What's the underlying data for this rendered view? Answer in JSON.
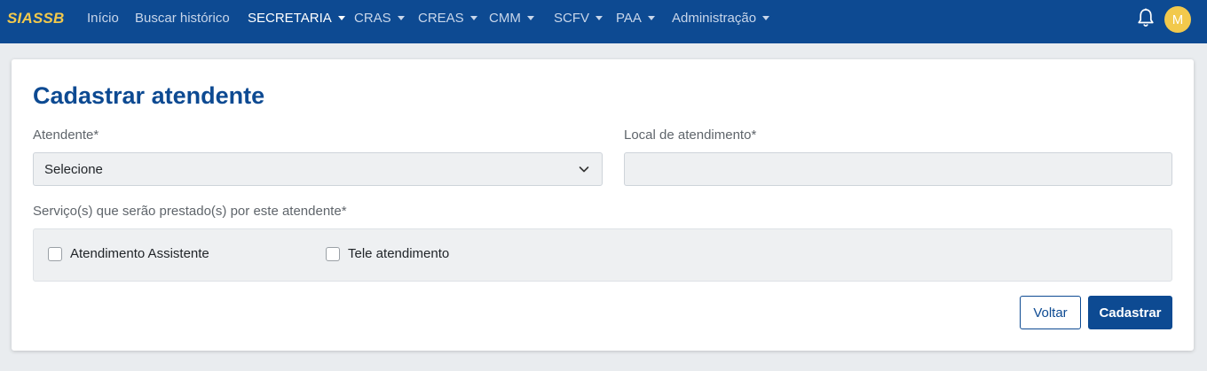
{
  "navbar": {
    "brand": "SIASSB",
    "items": [
      {
        "label": "Início",
        "dropdown": false
      },
      {
        "label": "Buscar histórico",
        "dropdown": false
      },
      {
        "label": "SECRETARIA",
        "dropdown": true
      },
      {
        "label": "CRAS",
        "dropdown": true
      },
      {
        "label": "CREAS",
        "dropdown": true
      },
      {
        "label": "CMM",
        "dropdown": true
      },
      {
        "label": "SCFV",
        "dropdown": true
      },
      {
        "label": "PAA",
        "dropdown": true
      },
      {
        "label": "Administração",
        "dropdown": true
      }
    ],
    "active_item": "SECRETARIA",
    "bell_icon": "bell-icon",
    "avatar_initial": "M"
  },
  "form": {
    "title": "Cadastrar atendente",
    "atendente_label": "Atendente*",
    "atendente_value": "Selecione",
    "local_label": "Local de atendimento*",
    "local_value": "",
    "servicos_label": "Serviço(s) que serão prestado(s) por este atendente*",
    "servicos": [
      {
        "label": "Atendimento Assistente",
        "checked": false
      },
      {
        "label": "Tele atendimento",
        "checked": false
      }
    ],
    "voltar_label": "Voltar",
    "cadastrar_label": "Cadastrar"
  },
  "colors": {
    "primary": "#0d4a92",
    "brand": "#f2c94c",
    "background": "#e9ecef"
  }
}
